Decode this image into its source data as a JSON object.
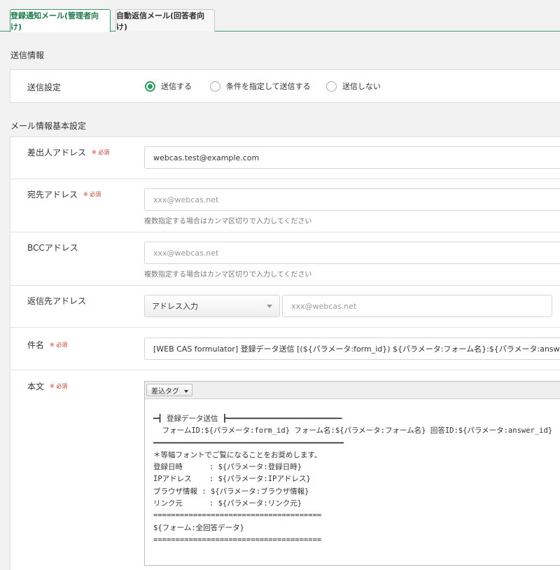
{
  "tabs": [
    {
      "label": "登録通知メール(管理者向け)",
      "active": true
    },
    {
      "label": "自動返信メール(回答者向け)",
      "active": false
    }
  ],
  "send_info": {
    "section_title": "送信情報",
    "label": "送信設定",
    "options": [
      {
        "label": "送信する",
        "checked": true
      },
      {
        "label": "条件を指定して送信する",
        "checked": false
      },
      {
        "label": "送信しない",
        "checked": false
      }
    ]
  },
  "mail_basic": {
    "section_title": "メール情報基本設定",
    "required_mark": "※ 必須",
    "sender": {
      "label": "差出人アドレス",
      "value": "webcas.test@example.com"
    },
    "to": {
      "label": "宛先アドレス",
      "placeholder": "xxx@webcas.net",
      "hint": "複数指定する場合はカンマ区切りで入力してください"
    },
    "bcc": {
      "label": "BCCアドレス",
      "placeholder": "xxx@webcas.net",
      "hint": "複数指定する場合はカンマ区切りで入力してください"
    },
    "reply_to": {
      "label": "返信先アドレス",
      "select_value": "アドレス入力",
      "placeholder": "xxx@webcas.net"
    },
    "subject": {
      "label": "件名",
      "value": "[WEB CAS formulator] 登録データ送信 [(${パラメータ:form_id}) ${パラメータ:フォーム名}:${パラメータ:answer_id}]"
    },
    "body": {
      "label": "本文",
      "tag_button": "差込タグ",
      "lines": [
        "━┫ 登録データ送信 ┣━━━━━━━━━━━━━━━━━━━━━━━━━━",
        "  フォームID:${パラメータ:form_id} フォーム名:${パラメータ:フォーム名} 回答ID:${パラメータ:answer_id}",
        "━━━━━━━━━━━━━━━━━━━━━━━━━━━━━━━━━━━━━━━━━━━",
        "＊等幅フォントでご覧になることをお奨めします。",
        "登録日時      : ${パラメータ:登録日時}",
        "IPアドレス    : ${パラメータ:IPアドレス}",
        "ブラウザ情報 : ${パラメータ:ブラウザ情報}",
        "リンク元      : ${パラメータ:リンク元}",
        "======================================",
        "${フォーム:全回答データ}",
        "======================================"
      ]
    }
  }
}
